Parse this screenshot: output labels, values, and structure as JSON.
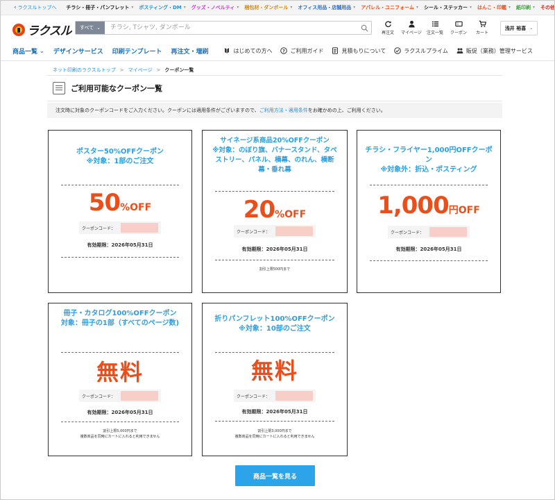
{
  "topstrip": {
    "back_label": "ラクスルトップへ",
    "categories": [
      {
        "label": "チラシ・冊子・パンフレット",
        "color": "#222222"
      },
      {
        "label": "ポスティング・DM",
        "color": "#2a8fd4"
      },
      {
        "label": "グッズ・ノベルティ",
        "color": "#c23ac2"
      },
      {
        "label": "梱包材・ダンボール",
        "color": "#d08a1a"
      },
      {
        "label": "オフィス用品・店舗用品",
        "color": "#2f6ec7"
      },
      {
        "label": "アパレル・ユニフォーム",
        "color": "#e0511e"
      },
      {
        "label": "シール・ステッカー",
        "color": "#222222"
      },
      {
        "label": "はんこ・印鑑",
        "color": "#e0511e"
      },
      {
        "label": "紙印刷",
        "color": "#3aa43a"
      },
      {
        "label": "その他",
        "color": "#e0241e"
      }
    ]
  },
  "header": {
    "logo_text": "ラクスル",
    "search": {
      "scope": "すべて",
      "placeholder": "チラシ, Tシャツ, ダンボール"
    },
    "icons": [
      {
        "label": "再注文",
        "icon": "reorder-icon"
      },
      {
        "label": "マイページ",
        "icon": "user-icon"
      },
      {
        "label": "注文一覧",
        "icon": "list-icon"
      },
      {
        "label": "クーポン",
        "icon": "coupon-icon"
      },
      {
        "label": "カート",
        "icon": "cart-icon"
      }
    ],
    "user_name": "浅井 裕喜"
  },
  "nav": {
    "items": [
      "商品一覧",
      "デザインサービス",
      "印刷テンプレート",
      "再注文・増刷"
    ],
    "guides": [
      {
        "label": "はじめての方へ",
        "icon": "beginner-icon"
      },
      {
        "label": "ご利用ガイド",
        "icon": "question-icon"
      },
      {
        "label": "見積もりについて",
        "icon": "estimate-icon"
      },
      {
        "label": "ラクスルプライム",
        "icon": "check-circle-icon"
      },
      {
        "label": "販促（業務）管理サービス",
        "icon": "people-icon"
      }
    ]
  },
  "breadcrumb": {
    "home": "ネット印刷のラクスルトップ",
    "mypage": "マイページ",
    "current": "クーポン一覧"
  },
  "page_title": "ご利用可能なクーポン一覧",
  "notice": {
    "before": "注文時に対象のクーポンコードをご入力ください。クーポンには適用条件がございますので、",
    "link": "ご利用方法・適用条件",
    "after": "をお確かめの上、ご利用ください。"
  },
  "coupons": [
    {
      "title": "ポスター50%OFFクーポン\n※対象：1部のご注文",
      "value": "50",
      "suffix": "%OFF",
      "code_label": "クーポンコード：",
      "expiry": "有効期限：2026年05月31日",
      "note": ""
    },
    {
      "title": "サイネージ系商品20%OFFクーポン\n※対象：のぼり旗、バナースタンド、タペストリー、パネル、横幕、のれん、横断幕・垂れ幕",
      "value": "20",
      "suffix": "%OFF",
      "code_label": "クーポンコード：",
      "expiry": "有効期限：2026年05月31日",
      "note": "割引上限500円まで"
    },
    {
      "title": "チラシ・フライヤー1,000円OFFクーポン\n※対象外：折込・ポスティング",
      "value": "1,000",
      "suffix": "円OFF",
      "code_label": "クーポンコード：",
      "expiry": "有効期限：2026年05月31日",
      "note": ""
    },
    {
      "title": "冊子・カタログ100%OFFクーポン\n対象：冊子の1部（すべてのページ数)",
      "value": "無料",
      "suffix": "",
      "code_label": "クーポンコード：",
      "expiry": "有効期限：2026年05月31日",
      "note": "割引上限5,000円まで\n複数商品を同時にカートに入れると利用できません"
    },
    {
      "title": "折りパンフレット100%OFFクーポン\n※対象：10部のご注文",
      "value": "無料",
      "suffix": "",
      "code_label": "クーポンコード：",
      "expiry": "有効期限：2026年05月31日",
      "note": "割引上限3,000円まで\n複数商品を同時にカートに入れると利用できません"
    }
  ],
  "cta": "商品一覧を見る"
}
